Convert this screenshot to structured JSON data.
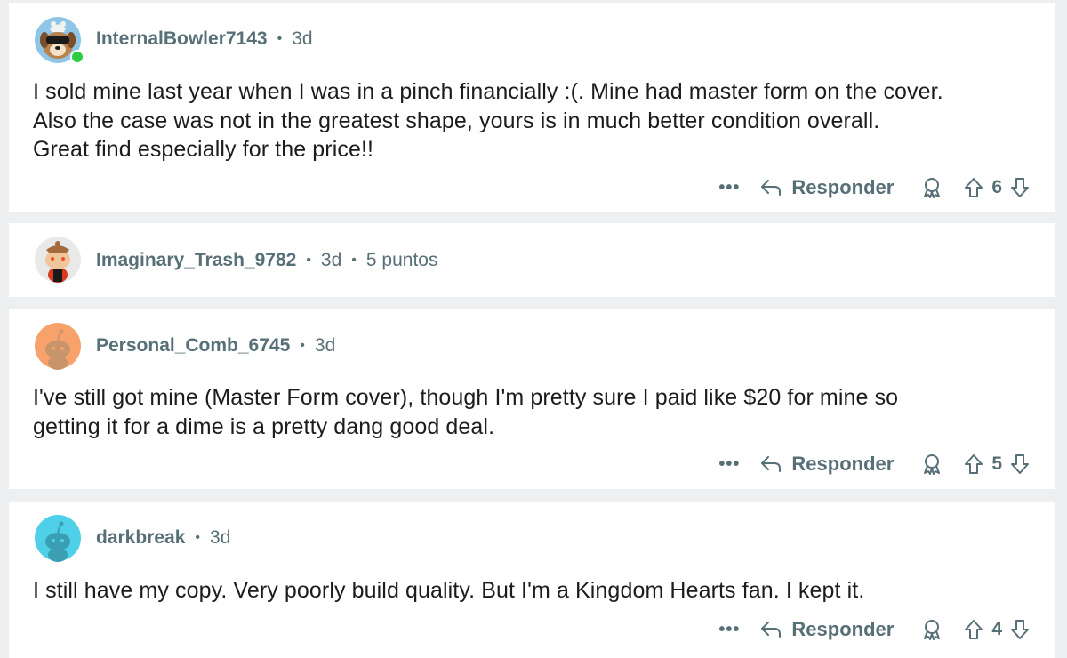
{
  "comments": [
    {
      "username": "InternalBowler7143",
      "age": "3d",
      "online": true,
      "avatar_icon": "sunglasses-dog-avatar-icon",
      "body_lines": [
        "I sold mine last year when I was in a pinch financially :(. Mine had master form on the cover.",
        "Also the case was not in the greatest shape, yours is in much better condition overall.",
        "Great find especially for the price!!"
      ],
      "more_label": "•••",
      "reply_label": "Responder",
      "score": "6"
    },
    {
      "username": "Imaginary_Trash_9782",
      "age": "3d",
      "points": "5 puntos",
      "avatar_icon": "snoo-avatar-icon",
      "collapsed": true
    },
    {
      "username": "Personal_Comb_6745",
      "age": "3d",
      "avatar_icon": "default-snoo-orange-icon",
      "body_lines": [
        "I've still got mine (Master Form cover), though I'm pretty sure I paid like $20 for mine so",
        "getting it for a dime is a pretty dang good deal."
      ],
      "more_label": "•••",
      "reply_label": "Responder",
      "score": "5"
    },
    {
      "username": "darkbreak",
      "age": "3d",
      "avatar_icon": "default-snoo-teal-icon",
      "body_lines": [
        "I still have my copy. Very poorly build quality. But I'm a Kingdom Hearts fan. I kept it."
      ],
      "more_label": "•••",
      "reply_label": "Responder",
      "score": "4"
    }
  ],
  "colors": {
    "background": "#edeff1",
    "card": "#ffffff",
    "meta_text": "#576f76",
    "body_text": "#1c1c1c",
    "online": "#2ecc40",
    "avatar_orange": "#f6a26a",
    "avatar_teal": "#4fd0e9"
  }
}
